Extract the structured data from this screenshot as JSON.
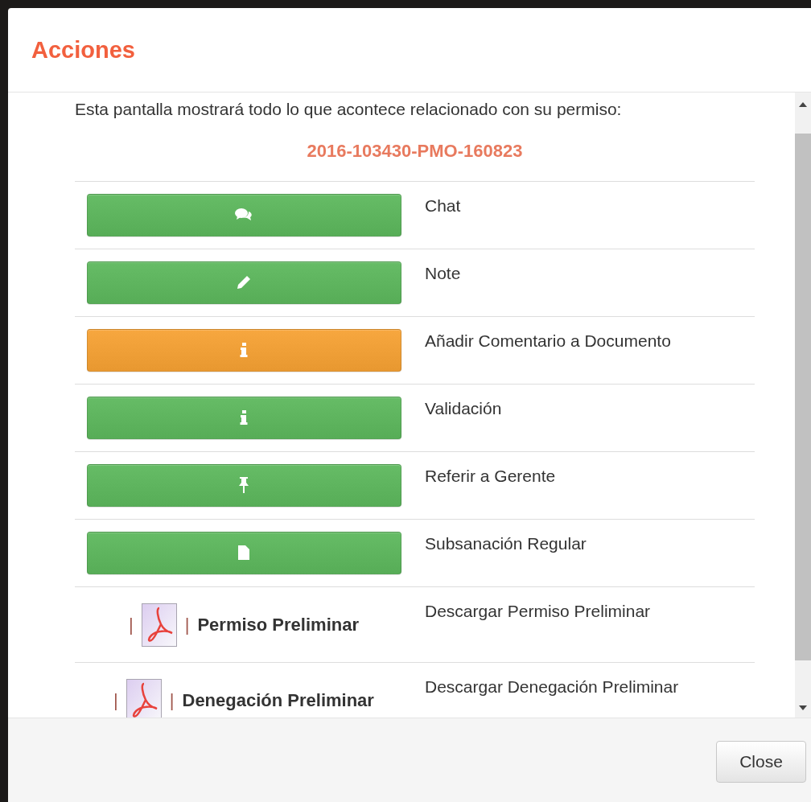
{
  "dialog": {
    "title": "Acciones",
    "intro": "Esta pantalla mostrará todo lo que acontece relacionado con su permiso:",
    "permit_number": "2016-103430-PMO-160823",
    "actions": [
      {
        "kind": "button",
        "color": "#5cb85c",
        "label": "Chat"
      },
      {
        "kind": "button",
        "color": "#5cb85c",
        "label": "Note"
      },
      {
        "kind": "button",
        "color": "#f7a233",
        "label": "Añadir Comentario a Documento"
      },
      {
        "kind": "button",
        "color": "#5cb85c",
        "label": "Validación"
      },
      {
        "kind": "button",
        "color": "#5cb85c",
        "label": "Referir a Gerente"
      },
      {
        "kind": "button",
        "color": "#5cb85c",
        "label": "Subsanación Regular"
      },
      {
        "kind": "document",
        "left_mark": "|",
        "right_mark": "|",
        "document": "Permiso Preliminar",
        "label": "Descargar Permiso Preliminar"
      },
      {
        "kind": "document",
        "left_mark": "|",
        "right_mark": "|",
        "document": "Denegación Preliminar",
        "label": "Descargar Denegación Preliminar"
      }
    ],
    "close_button": "Close"
  }
}
